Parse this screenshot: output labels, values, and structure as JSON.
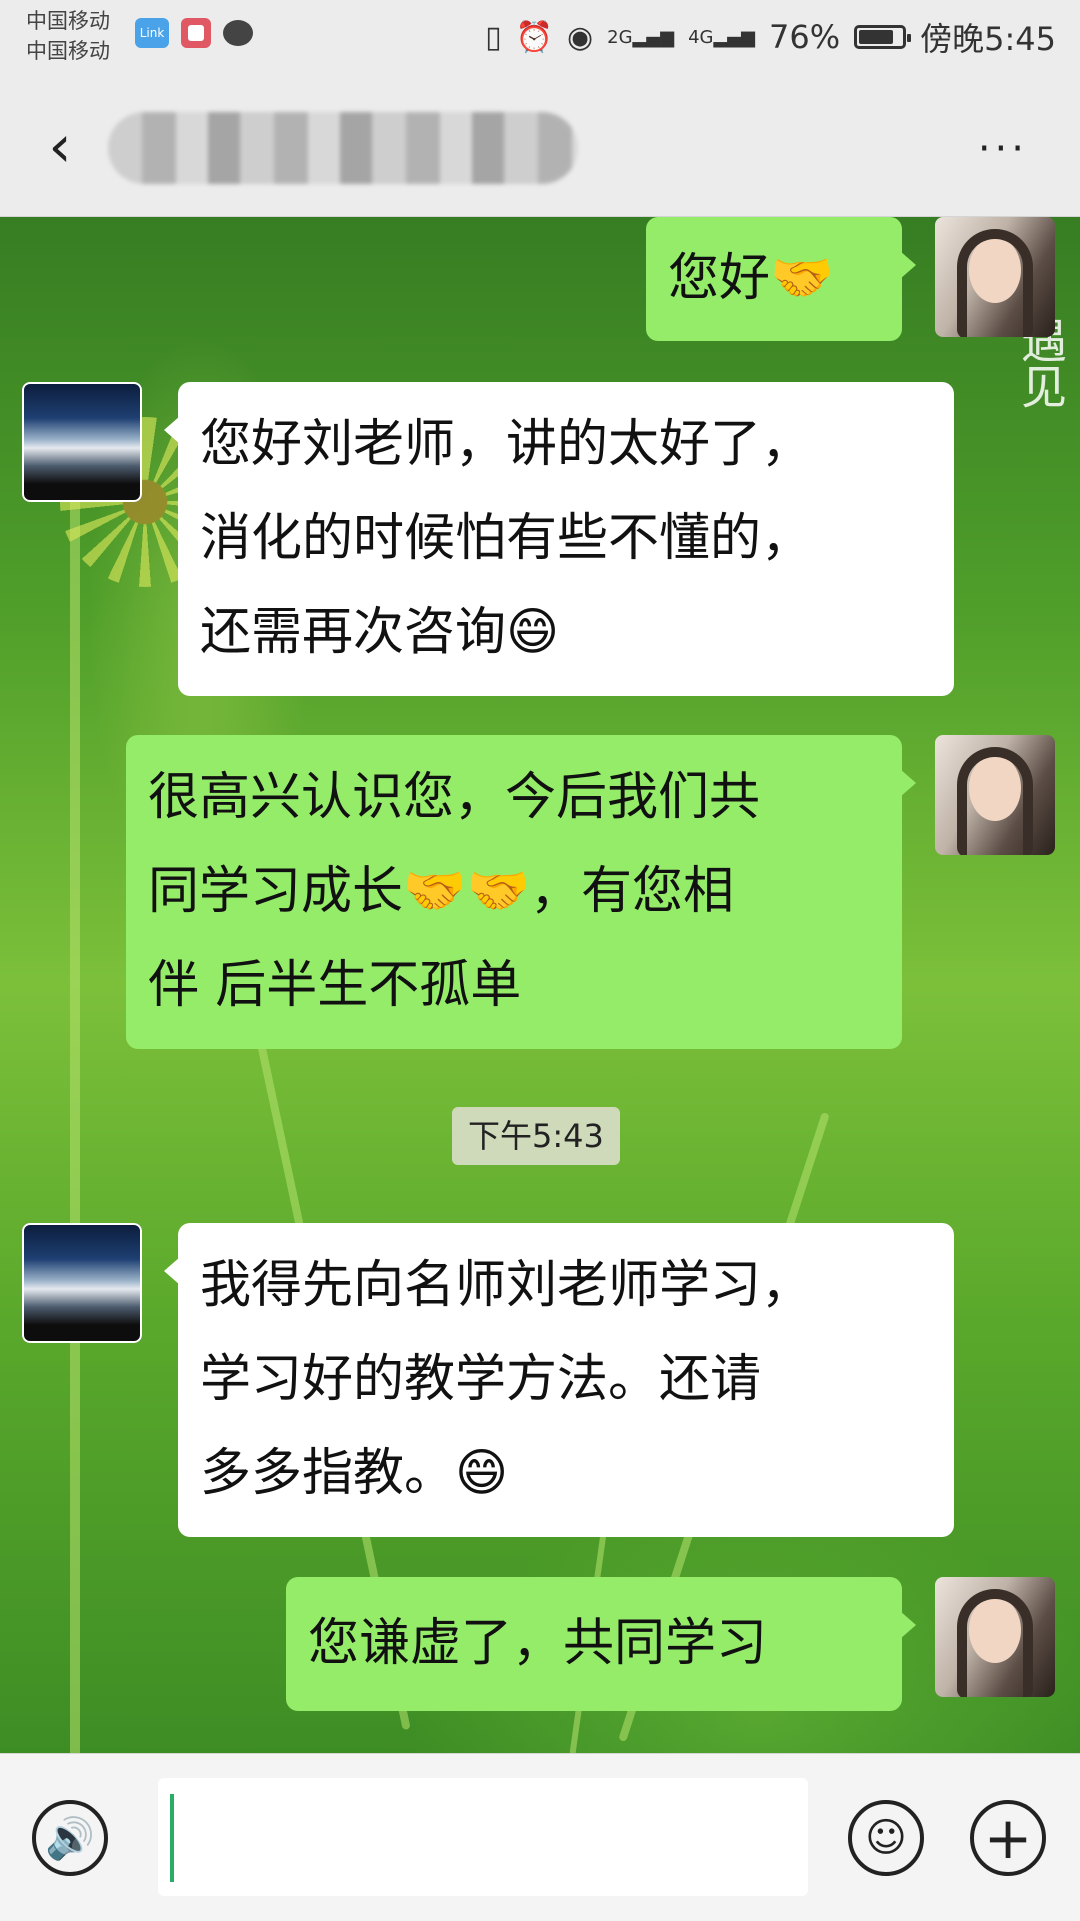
{
  "status_bar": {
    "carrier_1": "中国移动",
    "carrier_2": "中国移动",
    "link_badge": "Link",
    "left_icons": [
      "link-app-icon",
      "red-app-icon",
      "chat-notification-icon"
    ],
    "right_icons": [
      "vibrate-icon",
      "alarm-icon",
      "eye-icon",
      "signal-2g-icon",
      "signal-4g-icon"
    ],
    "signal_2g": "2G",
    "signal_4g": "4G",
    "battery_percent": "76%",
    "battery_level": 0.76,
    "time": "傍晚5:45"
  },
  "header": {
    "back_icon": "chevron-left-icon",
    "more_icon": "more-dots-icon",
    "back_glyph": "‹",
    "more_glyph": "···"
  },
  "chat": {
    "watermark": "遇见",
    "messages": [
      {
        "side": "out",
        "sender": "self",
        "lines": [
          "您好🤝"
        ]
      },
      {
        "side": "in",
        "sender": "friend",
        "lines": [
          "您好刘老师，讲的太好了，",
          "消化的时候怕有些不懂的，",
          "还需再次咨询😄"
        ]
      },
      {
        "side": "out",
        "sender": "self",
        "lines": [
          "很高兴认识您，今后我们共",
          "同学习成长🤝🤝，有您相",
          "伴  后半生不孤单"
        ]
      },
      {
        "side": "in",
        "sender": "friend",
        "lines": [
          "我得先向名师刘老师学习，",
          "学习好的教学方法。还请",
          "多多指教。😄"
        ]
      },
      {
        "side": "out",
        "sender": "self",
        "lines": [
          "您谦虚了，共同学习"
        ]
      }
    ],
    "timestamp": "下午5:43"
  },
  "input_bar": {
    "voice_icon": "voice-icon",
    "emoji_icon": "emoji-icon",
    "plus_icon": "plus-icon",
    "input_value": "",
    "voice_glyph": "🔊",
    "emoji_glyph": "☺",
    "plus_glyph": "+"
  }
}
